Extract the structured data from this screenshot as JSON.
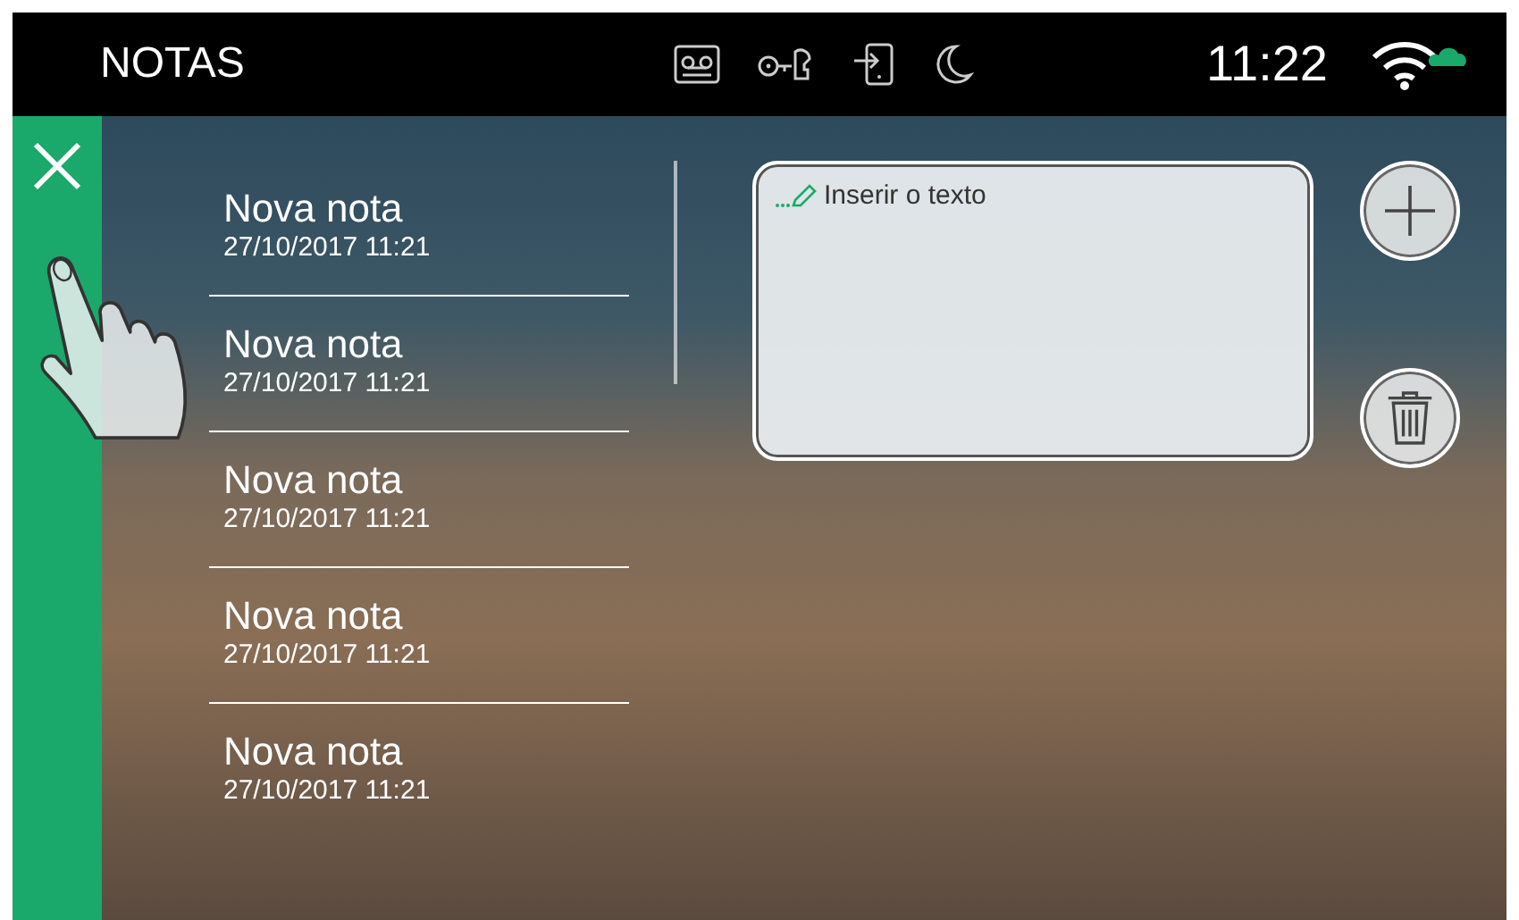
{
  "top_bar": {
    "title": "NOTAS",
    "time": "11:22"
  },
  "notes": [
    {
      "title": "Nova nota",
      "date": "27/10/2017 11:21"
    },
    {
      "title": "Nova nota",
      "date": "27/10/2017 11:21"
    },
    {
      "title": "Nova nota",
      "date": "27/10/2017 11:21"
    },
    {
      "title": "Nova nota",
      "date": "27/10/2017 11:21"
    },
    {
      "title": "Nova nota",
      "date": "27/10/2017 11:21"
    }
  ],
  "editor": {
    "placeholder": "Inserir o texto"
  }
}
